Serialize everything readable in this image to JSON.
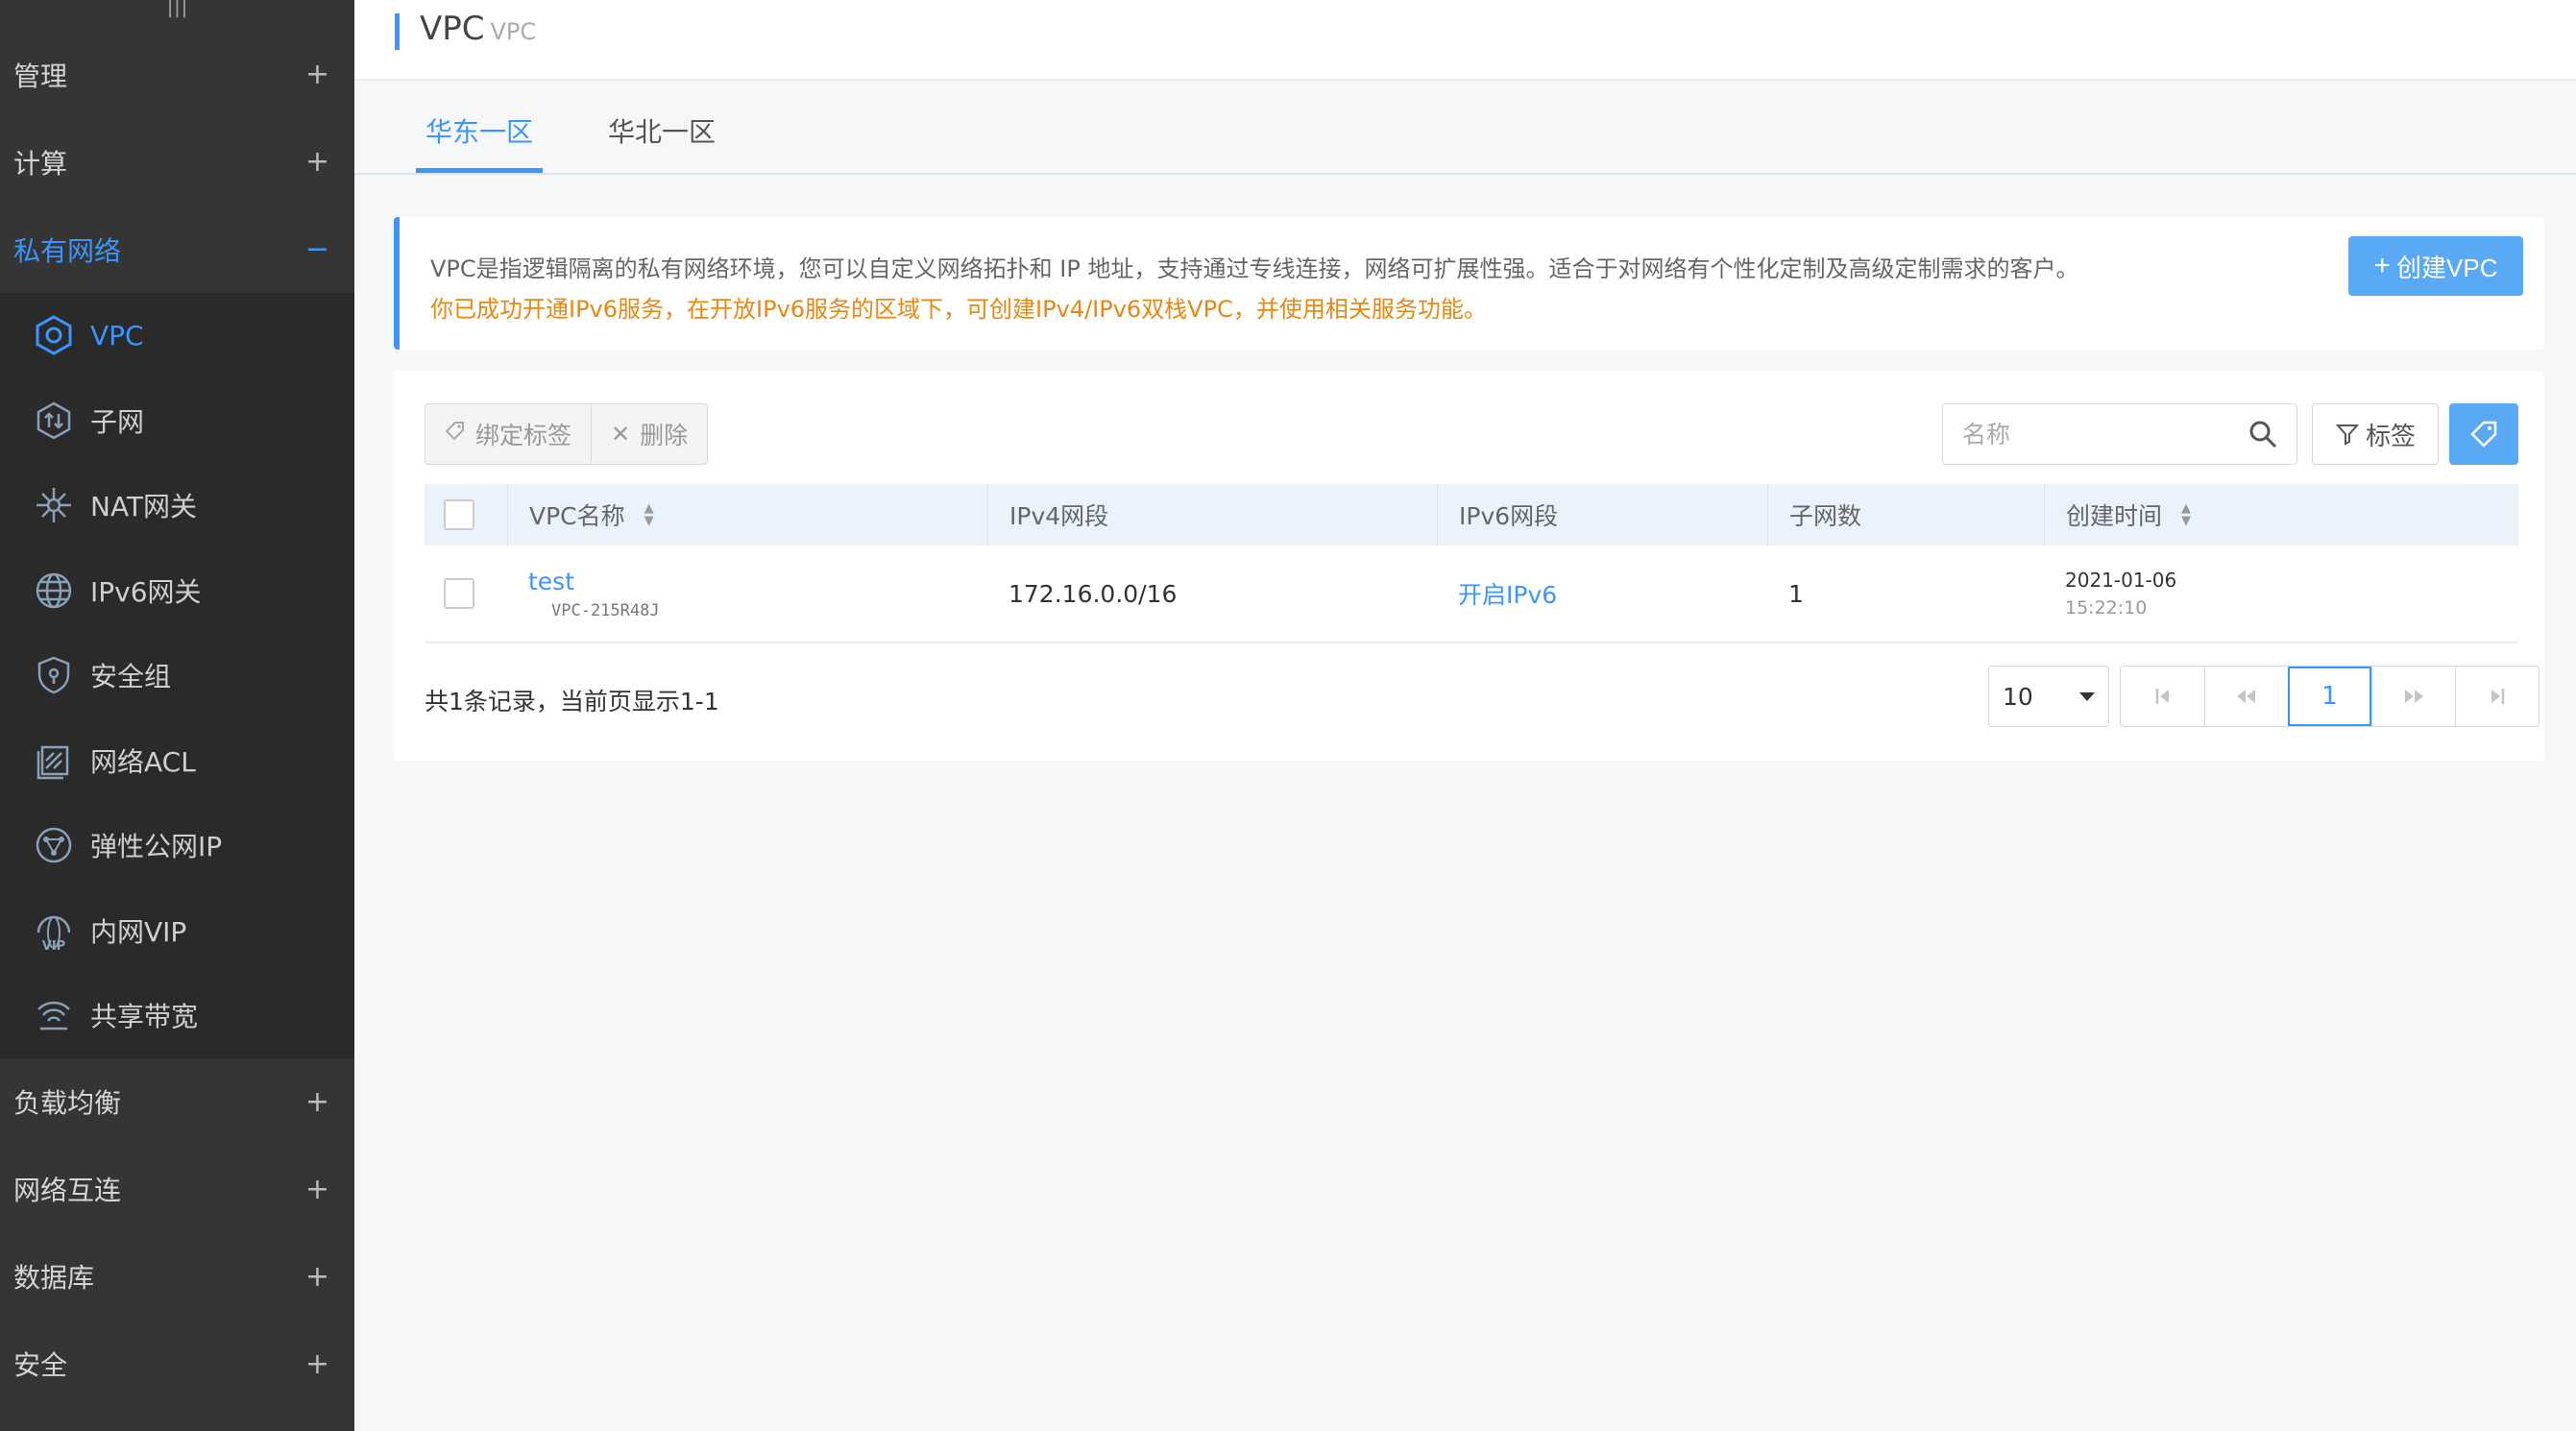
{
  "sidebar": {
    "groups_top": [
      {
        "label": "管理",
        "sign": "+"
      },
      {
        "label": "计算",
        "sign": "+"
      },
      {
        "label": "私有网络",
        "sign": "−"
      }
    ],
    "network_items": [
      {
        "label": "VPC",
        "icon": "vpc-hexagon-icon"
      },
      {
        "label": "子网",
        "icon": "subnet-icon"
      },
      {
        "label": "NAT网关",
        "icon": "nat-gateway-icon"
      },
      {
        "label": "IPv6网关",
        "icon": "globe-icon"
      },
      {
        "label": "安全组",
        "icon": "shield-lock-icon"
      },
      {
        "label": "网络ACL",
        "icon": "acl-icon"
      },
      {
        "label": "弹性公网IP",
        "icon": "network-nodes-icon"
      },
      {
        "label": "内网VIP",
        "icon": "vip-globe-icon"
      },
      {
        "label": "共享带宽",
        "icon": "wifi-bandwidth-icon"
      }
    ],
    "groups_bottom": [
      {
        "label": "负载均衡",
        "sign": "+"
      },
      {
        "label": "网络互连",
        "sign": "+"
      },
      {
        "label": "数据库",
        "sign": "+"
      },
      {
        "label": "安全",
        "sign": "+"
      }
    ],
    "handle": "|||"
  },
  "header": {
    "title": "VPC",
    "subtitle": "VPC"
  },
  "tabs": [
    {
      "label": "华东一区"
    },
    {
      "label": "华北一区"
    }
  ],
  "notice": {
    "line1": "VPC是指逻辑隔离的私有网络环境，您可以自定义网络拓扑和 IP 地址，支持通过专线连接，网络可扩展性强。适合于对网络有个性化定制及高级定制需求的客户。",
    "line2": "你已成功开通IPv6服务，在开放IPv6服务的区域下，可创建IPv4/IPv6双栈VPC，并使用相关服务功能。",
    "create_label": "创建VPC"
  },
  "toolbar": {
    "bind_tag_label": "绑定标签",
    "delete_label": "删除",
    "search_placeholder": "名称",
    "tag_filter_label": "标签"
  },
  "table": {
    "columns": [
      "VPC名称",
      "IPv4网段",
      "IPv6网段",
      "子网数",
      "创建时间"
    ],
    "rows": [
      {
        "name": "test",
        "id": "VPC-215R48J",
        "ipv4": "172.16.0.0/16",
        "ipv6": "开启IPv6",
        "subnets": "1",
        "date": "2021-01-06",
        "time": "15:22:10"
      }
    ]
  },
  "pagination": {
    "summary": "共1条记录，当前页显示1-1",
    "page_size": "10",
    "current_page": "1"
  },
  "colors": {
    "accent": "#3a96ff",
    "sidebar_bg": "#353535",
    "warning": "#e9870f"
  }
}
